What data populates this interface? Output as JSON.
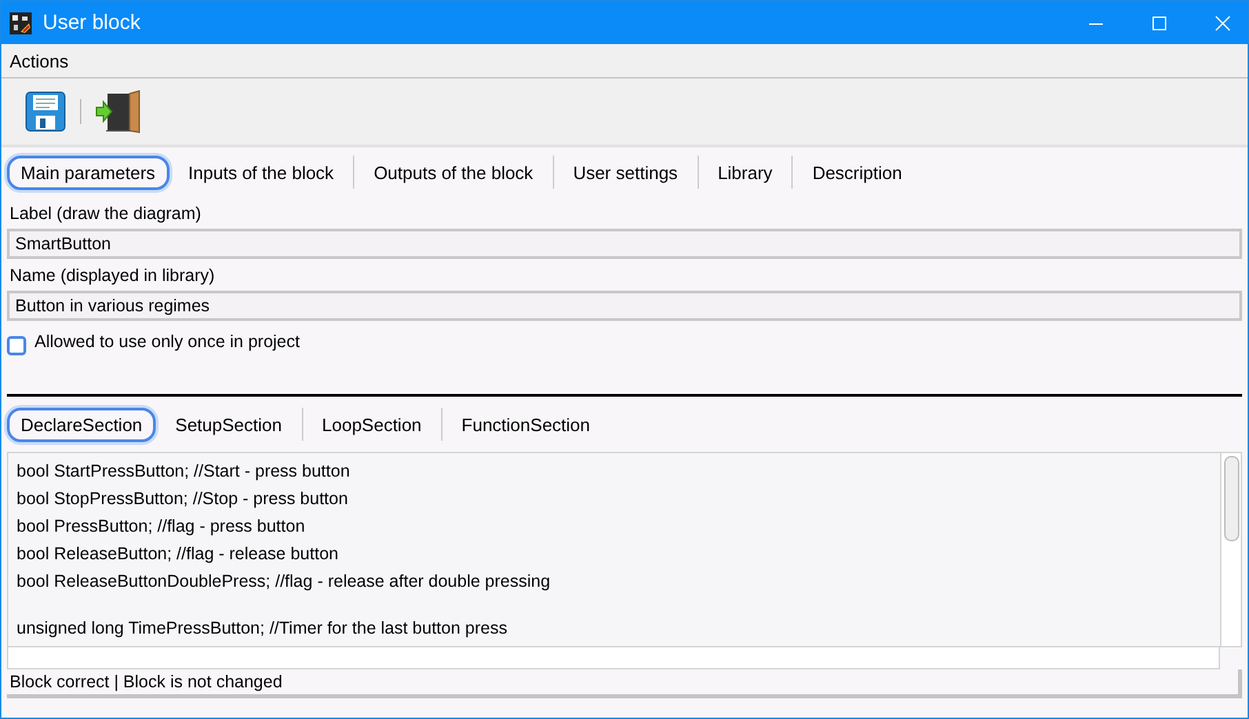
{
  "window": {
    "title": "User block"
  },
  "menu": [
    "Actions"
  ],
  "toolbar": [
    {
      "kind": "save"
    },
    {
      "kind": "exit"
    }
  ],
  "tabs": [
    {
      "label": "Main parameters",
      "selected": true
    },
    {
      "label": "Inputs of the block",
      "selected": false
    },
    {
      "label": "Outputs of the block",
      "selected": false
    },
    {
      "label": "User settings",
      "selected": false
    },
    {
      "label": "Library",
      "selected": false
    },
    {
      "label": "Description",
      "selected": false
    }
  ],
  "fields": [
    {
      "label": "Label (draw the diagram)",
      "value": "SmartButton"
    },
    {
      "label": "Name (displayed in library)",
      "value": "Button in various regimes"
    }
  ],
  "checkbox": {
    "label": "Allowed to use only once in project",
    "checked": false
  },
  "code_tabs": [
    {
      "label": "DeclareSection",
      "selected": true
    },
    {
      "label": "SetupSection",
      "selected": false
    },
    {
      "label": "LoopSection",
      "selected": false
    },
    {
      "label": "FunctionSection",
      "selected": false
    }
  ],
  "code_blocks": [
    [
      "bool StartPressButton; //Start - press button",
      "bool StopPressButton; //Stop - press button",
      "bool PressButton; //flag - press button",
      "bool ReleaseButton; //flag - release button",
      "bool ReleaseButtonDoublePress; //flag - release after double pressing"
    ],
    [
      "unsigned long TimePressButton; //Timer for the last button press"
    ]
  ],
  "status_bar": "Block correct | Block is not changed"
}
